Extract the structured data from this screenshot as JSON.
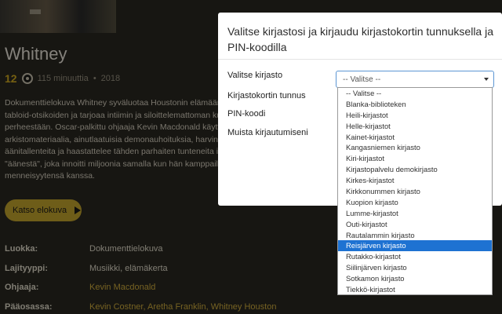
{
  "movie": {
    "title": "Whitney",
    "age_rating": "12",
    "duration": "115 minuuttia",
    "separator": "•",
    "year": "2018",
    "description_lines": [
      "Dokumenttielokuva Whitney syväluotaa Houstonin elämään ja",
      "tabloid-otsikoiden ja tarjoaa intiimin ja siloittelemattoman kuv",
      "perheestään. Oscar-palkittu ohjaaja Kevin Macdonald käytti",
      "arkistomateriaalia, ainutlaatuisia demonauhoituksia, harvinais",
      "äänitallenteita ja haastattelee tähden parhaiten tunteneita ihm",
      "\"äänestä\", joka innoitti miljoonia samalla kun hän kamppaili",
      "menneisyytensä kanssa."
    ],
    "watch_label": "Katso elokuva",
    "info": [
      {
        "label": "Luokka:",
        "value": "Dokumenttielokuva",
        "link": false
      },
      {
        "label": "Lajityyppi:",
        "value": "Musiikki, elämäkerta",
        "link": false
      },
      {
        "label": "Ohjaaja:",
        "value": "Kevin Macdonald",
        "link": true
      },
      {
        "label": "Pääosassa:",
        "value": "Kevin Costner, Aretha Franklin, Whitney Houston",
        "link": true
      }
    ]
  },
  "modal": {
    "title": "Valitse kirjastosi ja kirjaudu kirjastokortin tunnuksella ja PIN-koodilla",
    "fields": {
      "library_label": "Valitse kirjasto",
      "card_label": "Kirjastokortin tunnus",
      "pin_label": "PIN-koodi",
      "remember_label": "Muista kirjautumiseni"
    },
    "select_value": "-- Valitse --",
    "options": [
      "-- Valitse --",
      "Blanka-biblioteken",
      "Heili-kirjastot",
      "Helle-kirjastot",
      "Kainet-kirjastot",
      "Kangasniemen kirjasto",
      "Kiri-kirjastot",
      "Kirjastopalvelu demokirjasto",
      "Kirkes-kirjastot",
      "Kirkkonummen kirjasto",
      "Kuopion kirjasto",
      "Lumme-kirjastot",
      "Outi-kirjastot",
      "Rautalammin kirjasto",
      "Reisjärven kirjasto",
      "Rutakko-kirjastot",
      "Siilinjärven kirjasto",
      "Sotkamon kirjasto",
      "Tiekkö-kirjastot"
    ],
    "highlighted_option": "Reisjärven kirjasto"
  },
  "colors": {
    "accent": "#c9a92f",
    "highlight": "#1e72d2",
    "link": "#d7b33f"
  }
}
